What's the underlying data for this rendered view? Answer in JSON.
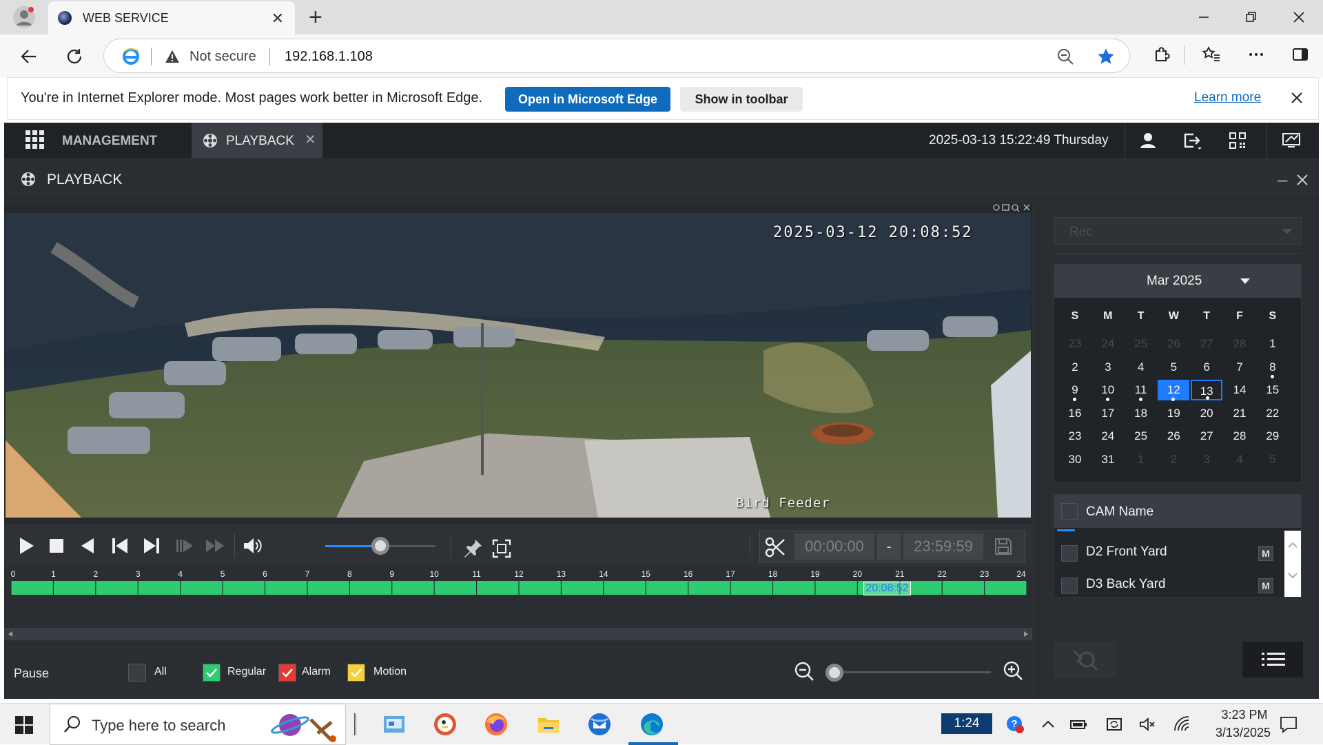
{
  "browser": {
    "tab_title": "WEB SERVICE",
    "tab_close": "✕",
    "new_tab": "+",
    "not_secure": "Not secure",
    "url": "192.168.1.108",
    "infobar": {
      "message": "You're in Internet Explorer mode. Most pages work better in Microsoft Edge.",
      "open_edge": "Open in Microsoft Edge",
      "show_toolbar": "Show in toolbar",
      "learn_more": "Learn more"
    }
  },
  "app": {
    "management_label": "MANAGEMENT",
    "playback_tab_label": "PLAYBACK",
    "playback_tab_close": "✕",
    "datetime": "2025-03-13 15:22:49 Thursday",
    "panel_title": "PLAYBACK",
    "panel_minimize": "–"
  },
  "video": {
    "osd_time": "2025-03-12 20:08:52",
    "osd_camera": "Bird Feeder"
  },
  "controls": {
    "volume_level": 0.5,
    "clip_start": "00:00:00",
    "clip_dash": "-",
    "clip_end": "23:59:59"
  },
  "timeline": {
    "hours": [
      "0",
      "1",
      "2",
      "3",
      "4",
      "5",
      "6",
      "7",
      "8",
      "9",
      "10",
      "11",
      "12",
      "13",
      "14",
      "15",
      "16",
      "17",
      "18",
      "19",
      "20",
      "21",
      "22",
      "23",
      "24"
    ],
    "cursor_time": "20:08:52",
    "cursor_hour": 20.148,
    "record_color": "#2ecc71"
  },
  "legend": {
    "status": "Pause",
    "items": [
      {
        "label": "All",
        "checked": false,
        "color": "#3a3e44"
      },
      {
        "label": "Regular",
        "checked": true,
        "color": "#2ecc71"
      },
      {
        "label": "Alarm",
        "checked": true,
        "color": "#e53935"
      },
      {
        "label": "Motion",
        "checked": true,
        "color": "#f4d03f"
      }
    ]
  },
  "right_panel": {
    "record_type": "Rec",
    "calendar": {
      "month": "Mar 2025",
      "dow": [
        "S",
        "M",
        "T",
        "W",
        "T",
        "F",
        "S"
      ],
      "weeks": [
        [
          {
            "d": "23",
            "o": true
          },
          {
            "d": "24",
            "o": true
          },
          {
            "d": "25",
            "o": true
          },
          {
            "d": "26",
            "o": true
          },
          {
            "d": "27",
            "o": true
          },
          {
            "d": "28",
            "o": true
          },
          {
            "d": "1"
          }
        ],
        [
          {
            "d": "2"
          },
          {
            "d": "3"
          },
          {
            "d": "4"
          },
          {
            "d": "5"
          },
          {
            "d": "6"
          },
          {
            "d": "7"
          },
          {
            "d": "8",
            "dot": true
          }
        ],
        [
          {
            "d": "9",
            "dot": true
          },
          {
            "d": "10",
            "dot": true
          },
          {
            "d": "11",
            "dot": true
          },
          {
            "d": "12",
            "dot": true,
            "sel": true
          },
          {
            "d": "13",
            "dot": true,
            "today": true
          },
          {
            "d": "14"
          },
          {
            "d": "15"
          }
        ],
        [
          {
            "d": "16"
          },
          {
            "d": "17"
          },
          {
            "d": "18"
          },
          {
            "d": "19"
          },
          {
            "d": "20"
          },
          {
            "d": "21"
          },
          {
            "d": "22"
          }
        ],
        [
          {
            "d": "23"
          },
          {
            "d": "24"
          },
          {
            "d": "25"
          },
          {
            "d": "26"
          },
          {
            "d": "27"
          },
          {
            "d": "28"
          },
          {
            "d": "29"
          }
        ],
        [
          {
            "d": "30"
          },
          {
            "d": "31"
          },
          {
            "d": "1",
            "o": true
          },
          {
            "d": "2",
            "o": true
          },
          {
            "d": "3",
            "o": true
          },
          {
            "d": "4",
            "o": true
          },
          {
            "d": "5",
            "o": true
          }
        ]
      ]
    },
    "cam_header": "CAM Name",
    "cameras": [
      {
        "name": "D2 Front Yard",
        "mode": "M"
      },
      {
        "name": "D3 Back Yard",
        "mode": "M"
      }
    ]
  },
  "taskbar": {
    "search_placeholder": "Type here to search",
    "badge_time": "1:24",
    "time": "3:23 PM",
    "date": "3/13/2025",
    "apps": [
      "control-panel-icon",
      "duckduckgo-icon",
      "firefox-icon",
      "file-explorer-icon",
      "thunderbird-icon",
      "edge-icon"
    ]
  },
  "colors": {
    "accent": "#1e7bff",
    "app_bg": "#2a2e33",
    "edge_blue": "#0f6cbd"
  }
}
